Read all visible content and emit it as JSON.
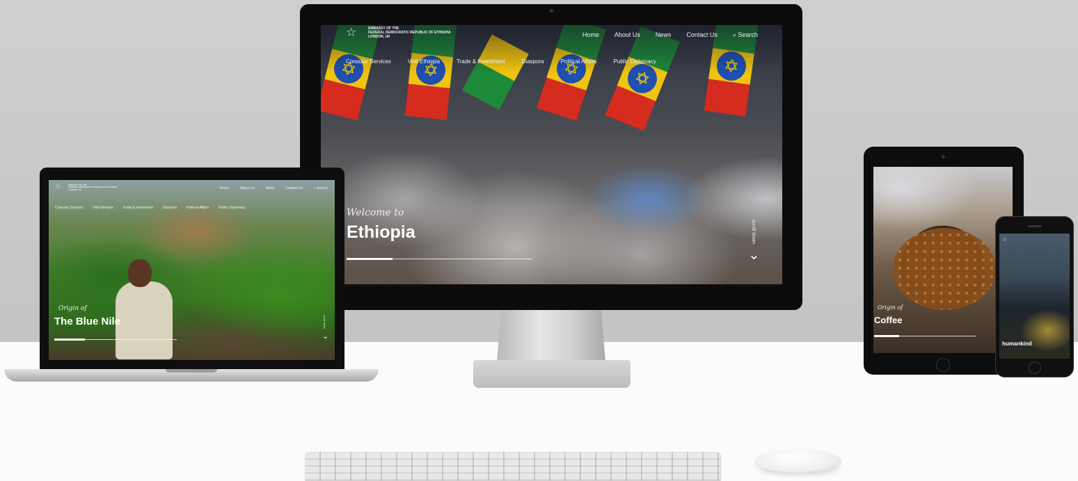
{
  "site": {
    "logo_lines": [
      "EMBASSY OF THE",
      "FEDERAL DEMOCRATIC REPUBLIC OF ETHIOPIA",
      "LONDON, UK"
    ],
    "top_nav": [
      "Home",
      "About Us",
      "News",
      "Contact Us"
    ],
    "search_label": "Search",
    "main_nav": [
      "Consular Services",
      "Visit Ethiopia",
      "Trade & Investment",
      "Diaspora",
      "Political Affairs",
      "Public Diplomacy"
    ],
    "scroll_label": "scroll down"
  },
  "desktop": {
    "welcome": "Welcome to",
    "title": "Ethiopia"
  },
  "laptop": {
    "welcome": "Origin of",
    "title": "The Blue Nile"
  },
  "tablet": {
    "welcome": "Origin of",
    "title": "Coffee"
  },
  "phone": {
    "title": "humankind"
  },
  "icons": {
    "star": "☆",
    "search": "⌕",
    "chevron": "⌄",
    "emblem": "✡"
  },
  "colors": {
    "flag_green": "#1d8a3a",
    "flag_yellow": "#f1c40f",
    "flag_red": "#d62b1f",
    "flag_blue": "#1f4fb0",
    "wall": "#c8c8c8",
    "desk": "#fbfbfb"
  }
}
